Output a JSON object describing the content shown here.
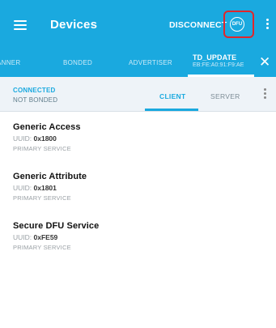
{
  "appbar": {
    "title": "Devices",
    "disconnect_label": "DISCONNECT",
    "dfu_icon_label": "DFU",
    "background_color": "#1aa9df",
    "highlight_color": "#e1262b"
  },
  "tabs": {
    "scanner": "ANNER",
    "bonded": "BONDED",
    "advertiser": "ADVERTISER",
    "device_name": "TD_UPDATE",
    "device_address": "EB:FE:A0:91:F9:AE"
  },
  "status": {
    "connection": "CONNECTED",
    "bond": "NOT BONDED"
  },
  "subtabs": {
    "client": "CLIENT",
    "server": "SERVER"
  },
  "services": [
    {
      "name": "Generic Access",
      "uuid_label": "UUID:",
      "uuid": "0x1800",
      "type": "PRIMARY SERVICE"
    },
    {
      "name": "Generic Attribute",
      "uuid_label": "UUID:",
      "uuid": "0x1801",
      "type": "PRIMARY SERVICE"
    },
    {
      "name": "Secure DFU Service",
      "uuid_label": "UUID:",
      "uuid": "0xFE59",
      "type": "PRIMARY SERVICE"
    }
  ]
}
